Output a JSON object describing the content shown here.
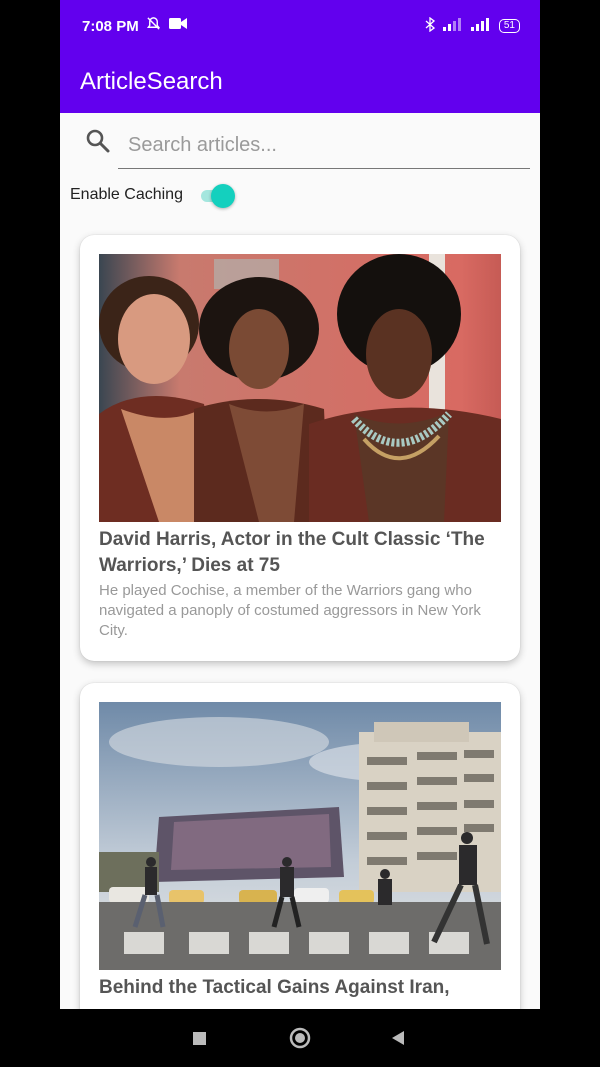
{
  "status_bar": {
    "time": "7:08 PM",
    "left_icons": [
      "alarm-off-icon",
      "video-camera-icon"
    ],
    "right_icons": [
      "bluetooth-icon",
      "signal-icon",
      "signal-icon"
    ],
    "battery": "51",
    "background": "#6200ee"
  },
  "app_bar": {
    "title": "ArticleSearch",
    "background": "#6200ee"
  },
  "search": {
    "placeholder": "Search articles...",
    "value": "",
    "icon": "search-icon"
  },
  "caching": {
    "label": "Enable Caching",
    "enabled": true,
    "accent": "#14d0be"
  },
  "articles": [
    {
      "title": "David Harris, Actor in the Cult Classic ‘The Warriors,’ Dies at 75",
      "abstract": "He played Cochise, a member of the Warriors gang who navigated a panoply of costumed aggressors in New York City.",
      "image": "photo-of-three-actors"
    },
    {
      "title": "Behind the Tactical Gains Against Iran,",
      "abstract": "",
      "image": "photo-of-city-street-crossing"
    }
  ],
  "nav": {
    "items": [
      "recents-icon",
      "home-icon",
      "back-icon"
    ]
  }
}
